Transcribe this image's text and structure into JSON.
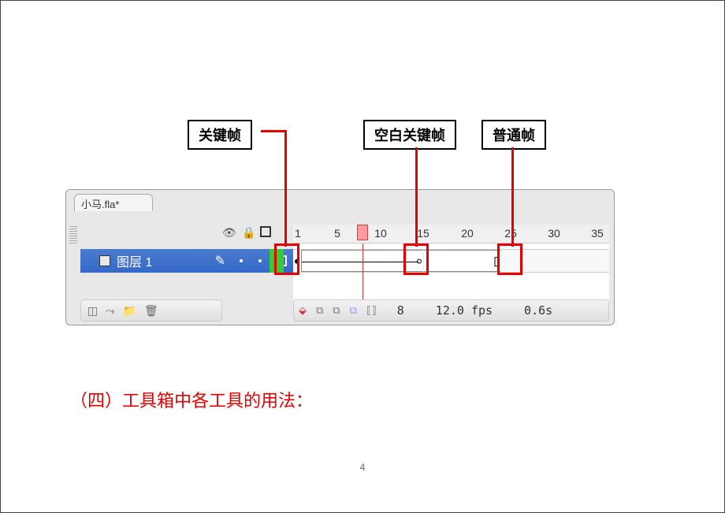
{
  "callouts": {
    "keyframe": "关键帧",
    "blank_keyframe": "空白关键帧",
    "normal_frame": "普通帧"
  },
  "tab": {
    "title": "小马.fla*"
  },
  "layer": {
    "name": "图层 1"
  },
  "ruler": {
    "ticks": [
      "1",
      "5",
      "10",
      "15",
      "20",
      "25",
      "30",
      "35"
    ]
  },
  "status": {
    "frame": "8",
    "fps": "12.0 fps",
    "time": "0.6s"
  },
  "section_title": "（四）工具箱中各工具的用法：",
  "page_number": "4"
}
